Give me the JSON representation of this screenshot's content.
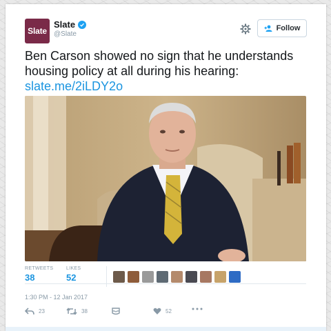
{
  "account": {
    "logo_text": "Slate",
    "name": "Slate",
    "handle": "@Slate"
  },
  "header": {
    "follow_label": "Follow"
  },
  "tweet": {
    "text_line1": "Ben Carson showed no sign that he understands",
    "text_line2": "housing policy at all during his hearing:",
    "link": "slate.me/2iLDY2o"
  },
  "stats": {
    "retweets_label": "RETWEETS",
    "retweets_value": "38",
    "likes_label": "LIKES",
    "likes_value": "52"
  },
  "timestamp": "1:30 PM - 12 Jan 2017",
  "actions": {
    "reply_count": "23",
    "retweet_count": "38",
    "like_count": "52"
  },
  "colors": {
    "brand": "#7a2a48",
    "link": "#1b95e0",
    "verified": "#1da1f2",
    "muted": "#8899a6"
  }
}
